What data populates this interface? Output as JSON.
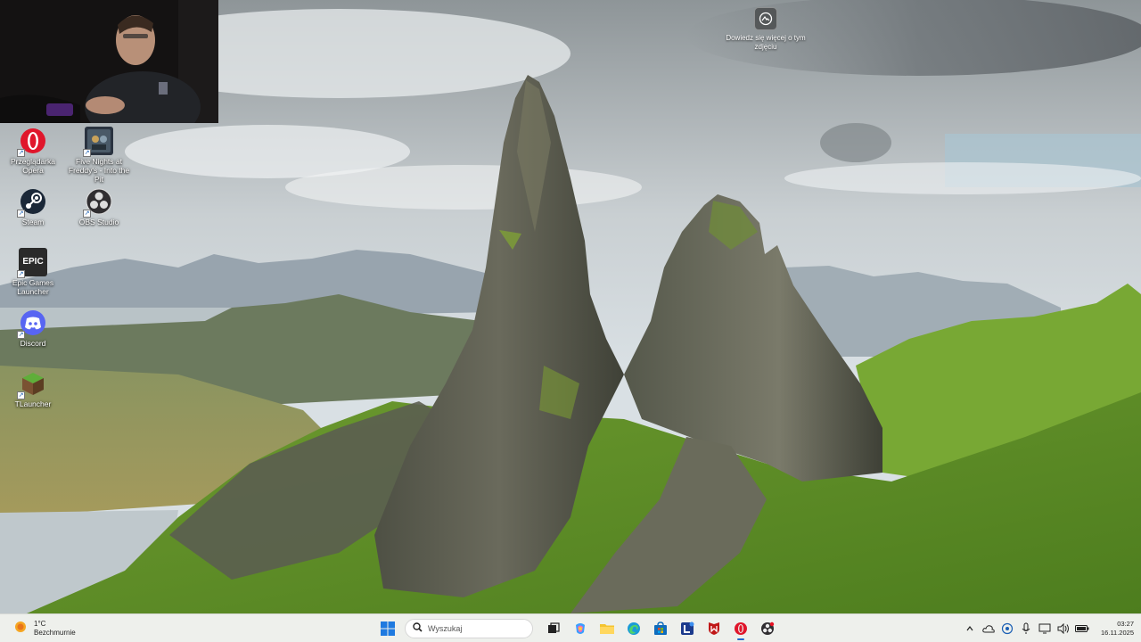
{
  "desktop": {
    "icons": [
      {
        "label": "Przeglądarka Opera",
        "icon": "opera-browser-icon"
      },
      {
        "label": "Five Nights at Freddy's - Into the Pit",
        "icon": "fnaf-game-icon"
      },
      {
        "label": "Steam",
        "icon": "steam-icon"
      },
      {
        "label": "OBS Studio",
        "icon": "obs-studio-icon"
      },
      {
        "label": "Epic Games Launcher",
        "icon": "epic-games-icon"
      },
      {
        "label": "Discord",
        "icon": "discord-icon"
      },
      {
        "label": "TLauncher",
        "icon": "tlauncher-icon"
      }
    ],
    "learn_more": {
      "label": "Dowiedz się więcej o tym zdjęciu",
      "icon": "camera-info-icon"
    },
    "epic_logo_text": "EPIC"
  },
  "taskbar": {
    "weather": {
      "temperature": "1°C",
      "condition": "Bezchmurnie",
      "icon": "weather-sun-icon"
    },
    "search": {
      "placeholder": "Wyszukaj",
      "value": ""
    },
    "pinned_apps": [
      {
        "name": "task-view",
        "icon": "task-view-icon"
      },
      {
        "name": "copilot",
        "icon": "copilot-icon"
      },
      {
        "name": "file-explorer",
        "icon": "folder-icon"
      },
      {
        "name": "edge",
        "icon": "edge-icon"
      },
      {
        "name": "microsoft-store",
        "icon": "store-icon"
      },
      {
        "name": "lenovo-vantage",
        "icon": "lenovo-icon"
      },
      {
        "name": "mcafee",
        "icon": "mcafee-icon"
      },
      {
        "name": "opera",
        "icon": "opera-icon"
      },
      {
        "name": "obs",
        "icon": "obs-icon"
      }
    ],
    "tray": [
      "chevron-up-icon",
      "onedrive-icon",
      "network-status-icon",
      "microphone-icon",
      "display-icon",
      "volume-icon",
      "battery-icon"
    ],
    "clock": {
      "time": "03:27",
      "date": "16.11.2025"
    }
  },
  "colors": {
    "taskbar_bg": "#eef0ec",
    "accent": "#2266cc",
    "opera_red": "#e0162b",
    "discord_blurple": "#5865f2",
    "steam_blue": "#1b2838"
  }
}
